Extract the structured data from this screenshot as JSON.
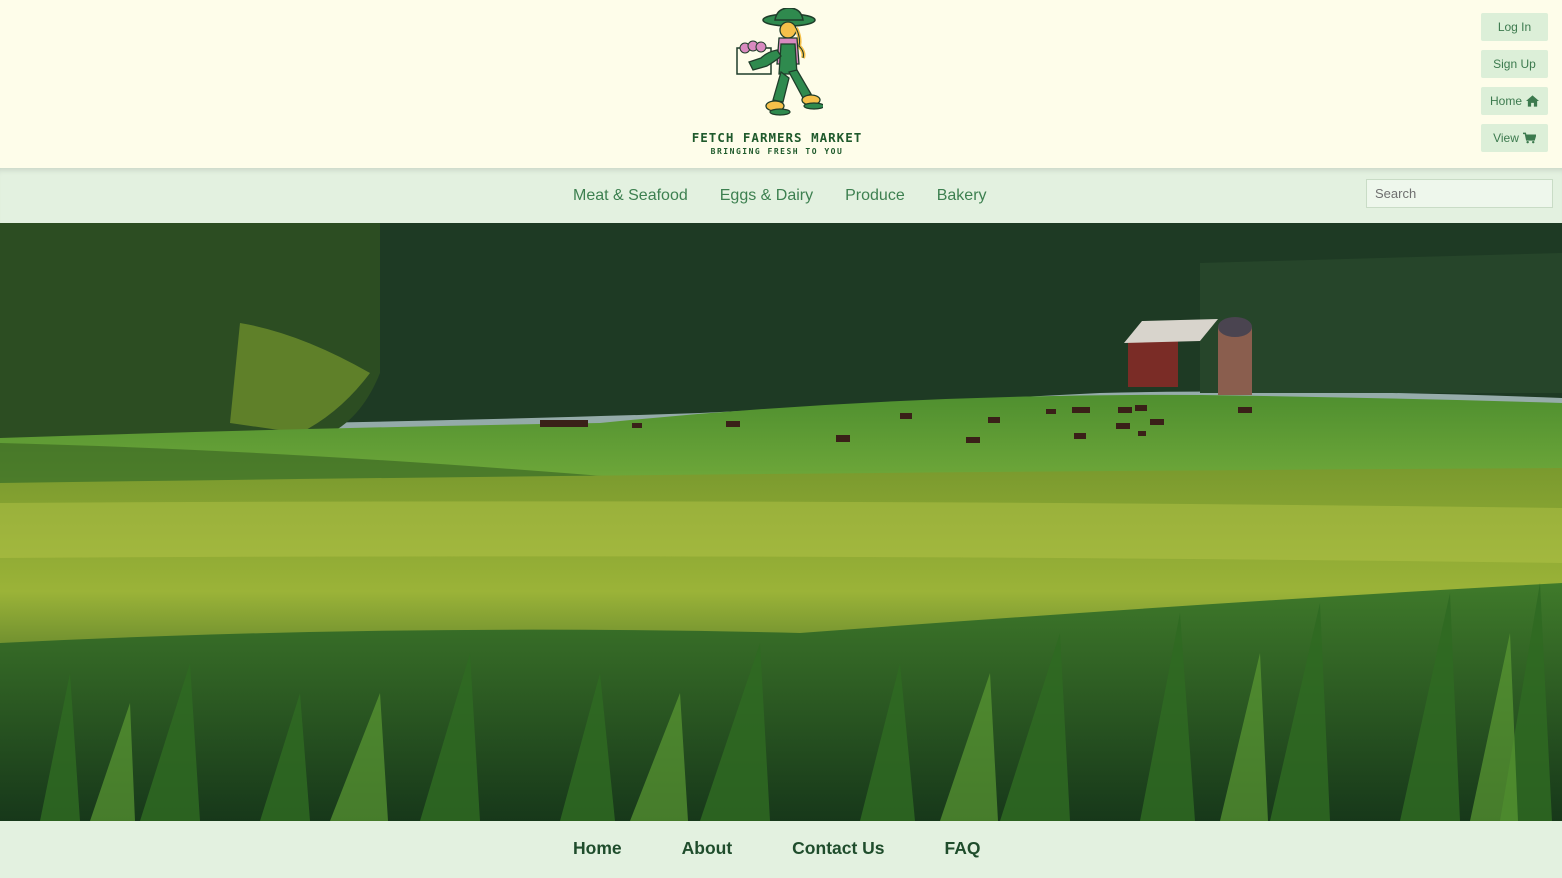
{
  "header": {
    "logo_title": "FETCH FARMERS MARKET",
    "logo_subtitle": "BRINGING FRESH TO YOU",
    "login_label": "Log In",
    "signup_label": "Sign Up",
    "home_label": "Home",
    "view_label": "View"
  },
  "nav": {
    "items": [
      {
        "label": "Meat & Seafood"
      },
      {
        "label": "Eggs & Dairy"
      },
      {
        "label": "Produce"
      },
      {
        "label": "Bakery"
      }
    ],
    "search_placeholder": "Search"
  },
  "footer": {
    "items": [
      {
        "label": "Home"
      },
      {
        "label": "About"
      },
      {
        "label": "Contact Us"
      },
      {
        "label": "FAQ"
      }
    ]
  },
  "colors": {
    "header_bg": "#fefdea",
    "nav_bg": "#e3f1e0",
    "accent_green": "#1f5a2c",
    "link_green": "#3d8050"
  }
}
